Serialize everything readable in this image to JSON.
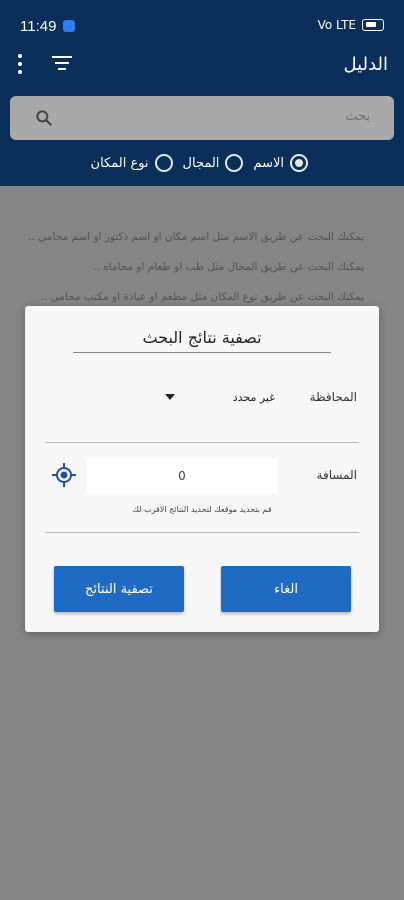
{
  "status_bar": {
    "time": "11:49",
    "signal_text": "Vo LTE",
    "battery_icon": "battery-icon"
  },
  "app_bar": {
    "title": "الدليل",
    "menu_icon": "more-vert-icon",
    "filter_icon": "filter-list-icon"
  },
  "search": {
    "placeholder": "بحث",
    "icon": "search-icon"
  },
  "search_type": {
    "options": [
      {
        "label": "الاسم",
        "selected": true
      },
      {
        "label": "المجال",
        "selected": false
      },
      {
        "label": "نوع المكان",
        "selected": false
      }
    ]
  },
  "hints": [
    "يمكنك البحث عن طريق الاسم مثل اسم مكان او اسم دكتور او اسم محامي ..",
    "يمكنك البحث عن طريق المجال مثل طب او طعام او محاماه ..",
    "يمكنك البحث عن طريق نوع المكان مثل مطعم او عيادة او مكتب محامي .."
  ],
  "dialog": {
    "title": "تصفية نتائج البحث",
    "governorate_label": "المحافظة",
    "governorate_value": "غير محدد",
    "distance_label": "المسافة",
    "distance_value": "0",
    "distance_hint": "قم بتحديد موقعك لتحديد النتائج الاقرب لك",
    "cancel_label": "الغاء",
    "filter_label": "تصفية النتائج"
  },
  "colors": {
    "primary": "#0a2f5a",
    "accent": "#1f6ac3",
    "scrim": "#858585"
  }
}
